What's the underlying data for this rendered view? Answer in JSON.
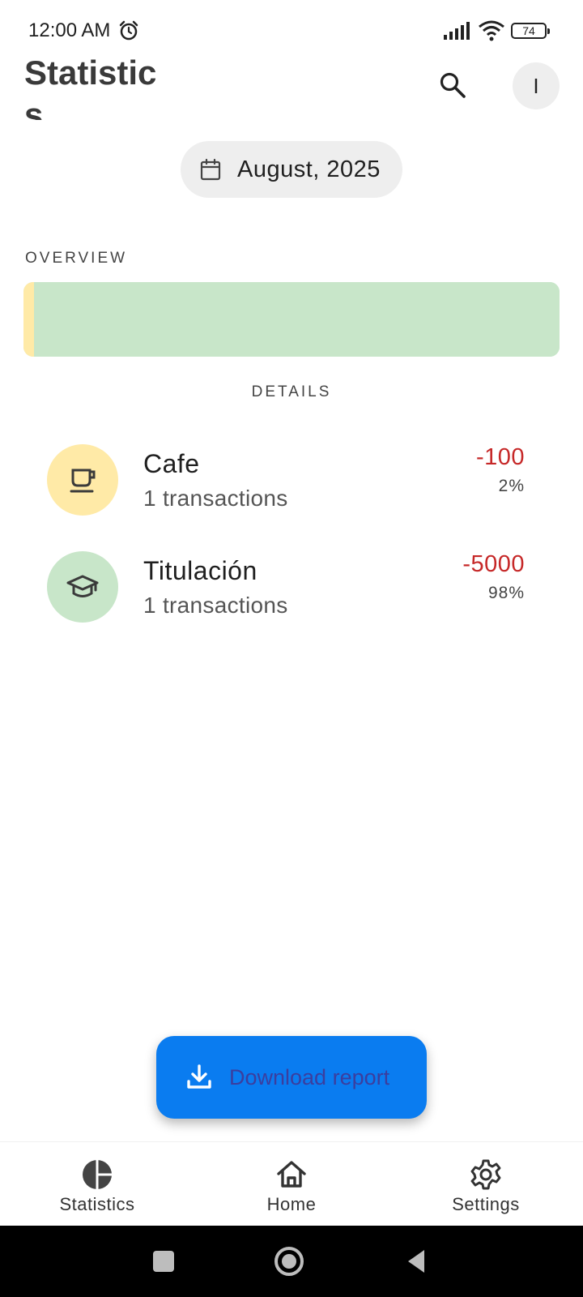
{
  "status_bar": {
    "time": "12:00 AM",
    "battery": "74",
    "icons": [
      "alarm-icon",
      "signal-icon",
      "wifi-icon",
      "battery-icon"
    ]
  },
  "header": {
    "title": "Statistics",
    "avatar_letter": "I",
    "icons": [
      "search-icon"
    ]
  },
  "month_selector": {
    "label": "August, 2025",
    "icon": "calendar-icon"
  },
  "overview": {
    "label": "OVERVIEW",
    "segments": [
      {
        "name": "Cafe",
        "share": 0.02,
        "color": "#ffeaa7"
      },
      {
        "name": "Titulación",
        "share": 0.98,
        "color": "#c8e6c9"
      }
    ]
  },
  "details": {
    "label": "DETAILS",
    "items": [
      {
        "name": "Cafe",
        "subtitle": "1 transactions",
        "amount": "-100",
        "percent": "2%",
        "icon": "coffee-cup-icon",
        "color": "#ffeaa7"
      },
      {
        "name": "Titulación",
        "subtitle": "1 transactions",
        "amount": "-5000",
        "percent": "98%",
        "icon": "graduation-cap-icon",
        "color": "#c8e6c9"
      }
    ]
  },
  "fab": {
    "label": "Download report",
    "icon": "download-icon",
    "color": "#0a7cf0"
  },
  "bottom_nav": {
    "items": [
      {
        "label": "Statistics",
        "icon": "pie-chart-icon"
      },
      {
        "label": "Home",
        "icon": "home-icon"
      },
      {
        "label": "Settings",
        "icon": "gear-icon"
      }
    ]
  },
  "colors": {
    "negative_amount": "#c62828",
    "chip_bg": "#eeeeee"
  }
}
